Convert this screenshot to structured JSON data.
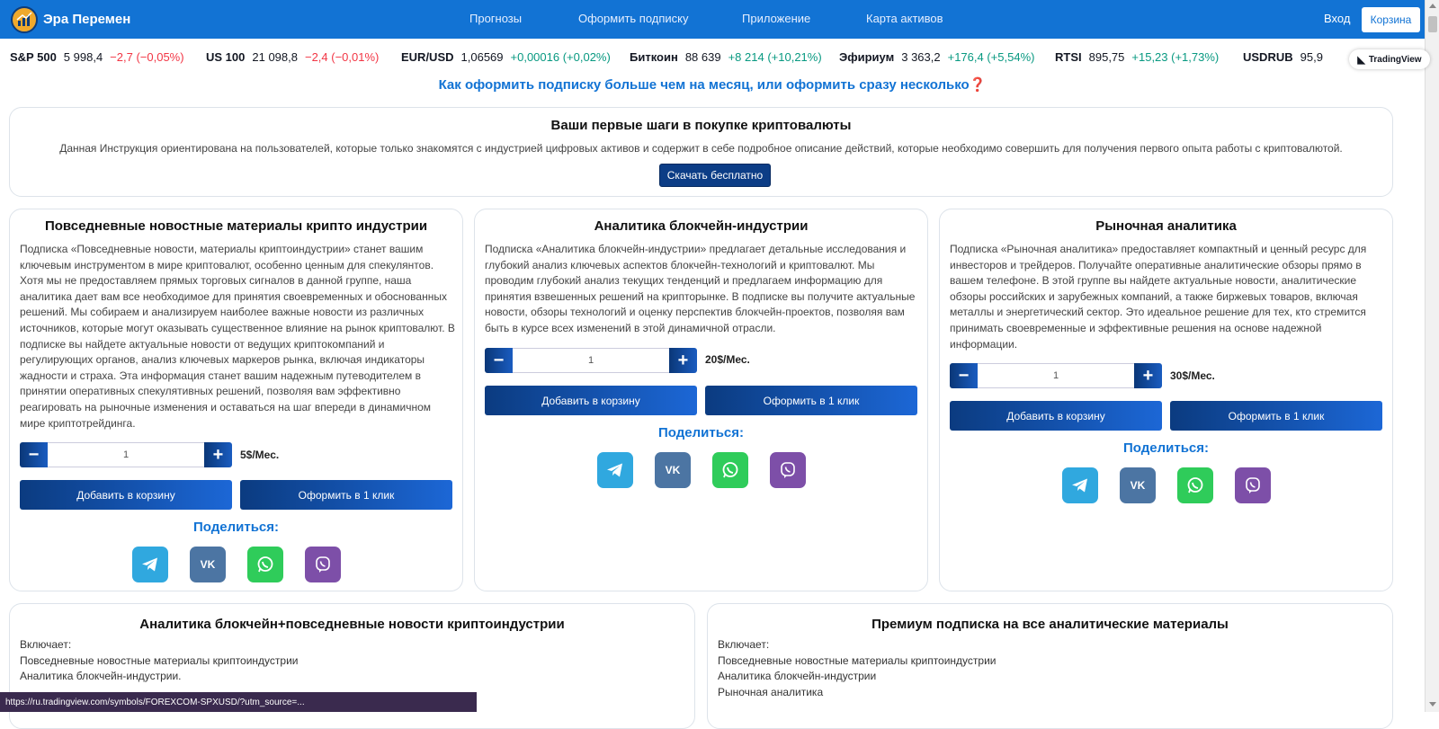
{
  "nav": {
    "brand": "Эра Перемен",
    "links": [
      "Прогнозы",
      "Оформить подписку",
      "Приложение",
      "Карта активов"
    ],
    "login": "Вход",
    "cart": "Корзина"
  },
  "ticker": [
    {
      "symbol": "S&P 500",
      "value": "5 998,4",
      "change": "−2,7 (−0,05%)",
      "dir": "neg"
    },
    {
      "symbol": "US 100",
      "value": "21 098,8",
      "change": "−2,4 (−0,01%)",
      "dir": "neg"
    },
    {
      "symbol": "EUR/USD",
      "value": "1,06569",
      "change": "+0,00016 (+0,02%)",
      "dir": "pos"
    },
    {
      "symbol": "Биткоин",
      "value": "88 639",
      "change": "+8 214 (+10,21%)",
      "dir": "pos"
    },
    {
      "symbol": "Эфириум",
      "value": "3 363,2",
      "change": "+176,4 (+5,54%)",
      "dir": "pos"
    },
    {
      "symbol": "RTSI",
      "value": "895,75",
      "change": "+15,23 (+1,73%)",
      "dir": "pos"
    },
    {
      "symbol": "USDRUB",
      "value": "95,9",
      "change": "",
      "dir": "pos"
    }
  ],
  "tradingview_label": "TradingView",
  "promo_link": "Как оформить подписку больше чем на месяц, или оформить сразу несколько❓",
  "intro": {
    "title": "Ваши первые шаги в покупке криптовалюты",
    "text": "Данная Инструкция ориентирована на пользователей, которые только знакомятся с индустрией цифровых активов и содержит в себе подробное описание действий, которые необходимо совершить для получения первого опыта работы с криптовалютой.",
    "button": "Скачать бесплатно"
  },
  "products": [
    {
      "title": "Повседневные новостные материалы крипто индустрии",
      "description": "Подписка «Повседневные новости, материалы криптоиндустрии» станет вашим ключевым инструментом в мире криптовалют, особенно ценным для спекулянтов. Хотя мы не предоставляем прямых торговых сигналов в данной группе, наша аналитика дает вам все необходимое для принятия своевременных и обоснованных решений. Мы собираем и анализируем наиболее важные новости из различных источников, которые могут оказывать существенное влияние на рынок криптовалют. В подписке вы найдете актуальные новости от ведущих криптокомпаний и регулирующих органов, анализ ключевых маркеров рынка, включая индикаторы жадности и страха. Эта информация станет вашим надежным путеводителем в принятии оперативных спекулятивных решений, позволяя вам эффективно реагировать на рыночные изменения и оставаться на шаг впереди в динамичном мире криптотрейдинга.",
      "qty": "1",
      "price": "5$/Мес.",
      "add_to_cart": "Добавить в корзину",
      "buy_one_click": "Оформить в 1 клик",
      "share": "Поделиться:"
    },
    {
      "title": "Аналитика блокчейн-индустрии",
      "description": "Подписка «Аналитика блокчейн-индустрии» предлагает детальные исследования и глубокий анализ ключевых аспектов блокчейн-технологий и криптовалют. Мы проводим глубокий анализ текущих тенденций и предлагаем информацию для принятия взвешенных решений на крипторынке. В подписке вы получите актуальные новости, обзоры технологий и оценку перспектив блокчейн-проектов, позволяя вам быть в курсе всех изменений в этой динамичной отрасли.",
      "qty": "1",
      "price": "20$/Мес.",
      "add_to_cart": "Добавить в корзину",
      "buy_one_click": "Оформить в 1 клик",
      "share": "Поделиться:"
    },
    {
      "title": "Рыночная аналитика",
      "description": "Подписка «Рыночная аналитика» предоставляет компактный и ценный ресурс для инвесторов и трейдеров. Получайте оперативные аналитические обзоры прямо в вашем телефоне. В этой группе вы найдете актуальные новости, аналитические обзоры российских и зарубежных компаний, а также биржевых товаров, включая металлы и энергетический сектор. Это идеальное решение для тех, кто стремится принимать своевременные и эффективные решения на основе надежной информации.",
      "qty": "1",
      "price": "30$/Мес.",
      "add_to_cart": "Добавить в корзину",
      "buy_one_click": "Оформить в 1 клик",
      "share": "Поделиться:"
    }
  ],
  "bundles": [
    {
      "title": "Аналитика блокчейн+повседневные новости криптоиндустрии",
      "includes": [
        "Включает:",
        "Повседневные новостные материалы криптоиндустрии",
        "Аналитика блокчейн-индустрии."
      ]
    },
    {
      "title": "Премиум подписка на все аналитические материалы",
      "includes": [
        "Включает:",
        "Повседневные новостные материалы криптоиндустрии",
        "Аналитика блокчейн-индустрии",
        "Рыночная аналитика"
      ]
    }
  ],
  "status_bar": "https://ru.tradingview.com/symbols/FOREXCOM-SPXUSD/?utm_source=..."
}
